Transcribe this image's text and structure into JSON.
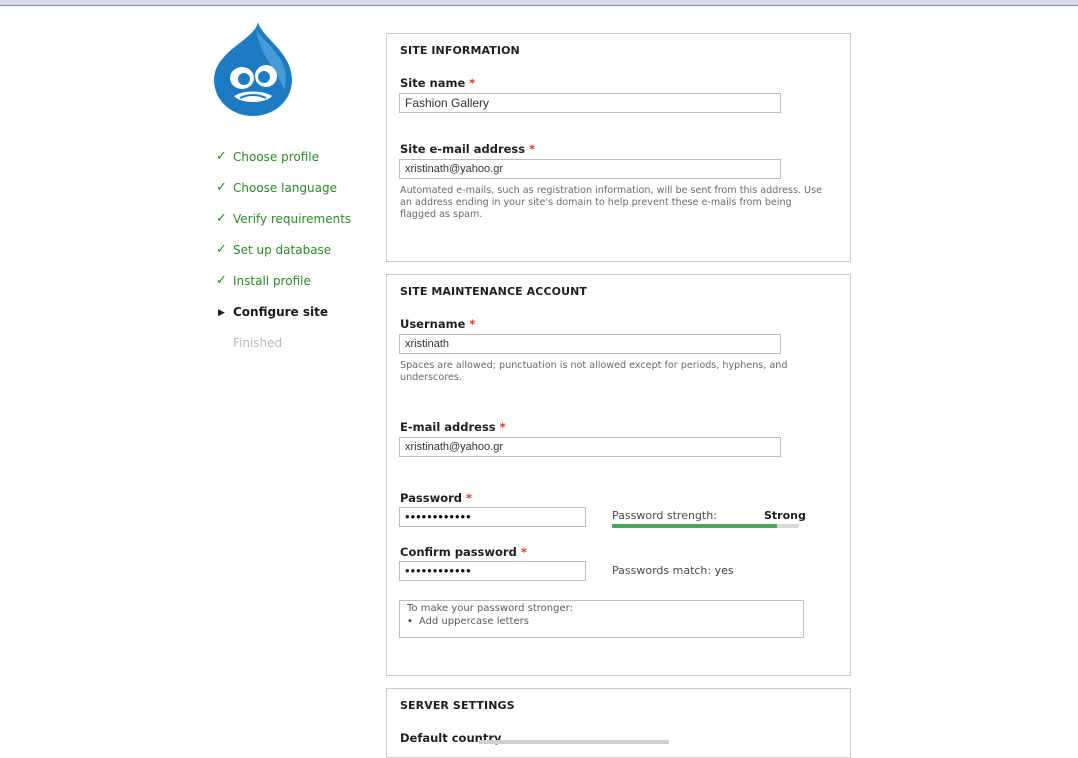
{
  "steps": [
    {
      "label": "Choose profile",
      "state": "done"
    },
    {
      "label": "Choose language",
      "state": "done"
    },
    {
      "label": "Verify requirements",
      "state": "done"
    },
    {
      "label": "Set up database",
      "state": "done"
    },
    {
      "label": "Install profile",
      "state": "done"
    },
    {
      "label": "Configure site",
      "state": "active"
    },
    {
      "label": "Finished",
      "state": "pending"
    }
  ],
  "icons": {
    "done": "check-icon",
    "active": "triangle-right-icon",
    "logo": "drupal-drop-logo"
  },
  "colors": {
    "done": "#2c8a26",
    "active": "#1b1b1b",
    "pending": "#b9b9b9",
    "required": "#e03c1a",
    "meter": "#49a85a",
    "logo_blue": "#1f7bc1"
  },
  "site_info": {
    "legend": "SITE INFORMATION",
    "site_name_label": "Site name",
    "site_name_value": "Fashion Gallery",
    "email_label": "Site e-mail address",
    "email_value": "xristinath@yahoo.gr",
    "email_desc": "Automated e-mails, such as registration information, will be sent from this address. Use an address ending in your site's domain to help prevent these e-mails from being flagged as spam."
  },
  "maintenance": {
    "legend": "SITE MAINTENANCE ACCOUNT",
    "username_label": "Username",
    "username_value": "xristinath",
    "username_desc": "Spaces are allowed; punctuation is not allowed except for periods, hyphens, and underscores.",
    "email_label": "E-mail address",
    "email_value": "xristinath@yahoo.gr",
    "password_label": "Password",
    "password_value": "••••••••••••",
    "strength_label": "Password strength:",
    "strength_value": "Strong",
    "strength_fraction": 0.88,
    "confirm_label": "Confirm password",
    "confirm_value": "••••••••••••",
    "match_label": "Passwords match:",
    "match_value": "yes",
    "tips_title": "To make your password stronger:",
    "tips": [
      "Add uppercase letters"
    ]
  },
  "server": {
    "legend": "SERVER SETTINGS",
    "country_label": "Default country"
  },
  "required_marker": "*"
}
